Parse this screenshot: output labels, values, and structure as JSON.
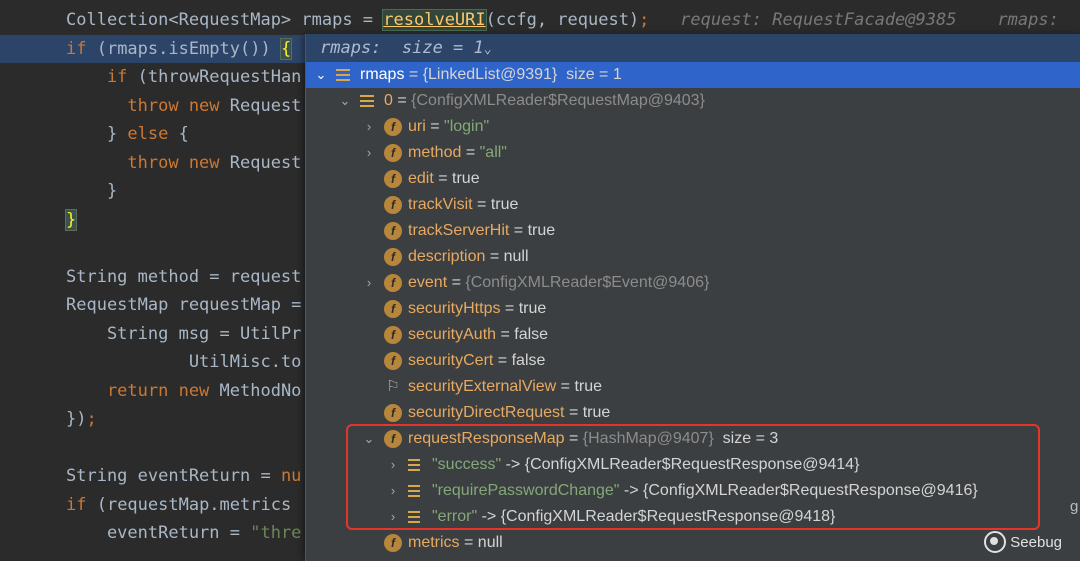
{
  "editor": {
    "lines": [
      {
        "id": "l1",
        "parts": [
          [
            "Collection<RequestMap> rmaps = ",
            ""
          ],
          [
            "resolveURI",
            "method-box"
          ],
          [
            "(ccfg, request)",
            ""
          ],
          [
            ";",
            "k"
          ],
          [
            "   request: RequestFacade@9385    rmaps:",
            "hint"
          ]
        ]
      },
      {
        "id": "l2",
        "parts": [
          [
            "if ",
            "k"
          ],
          [
            "(rmaps.isEmpty()) ",
            ""
          ],
          [
            "{",
            "brace-hl"
          ]
        ]
      },
      {
        "id": "l3",
        "parts": [
          [
            "    if ",
            "k"
          ],
          [
            "(throwRequestHan",
            ""
          ]
        ]
      },
      {
        "id": "l4",
        "parts": [
          [
            "      throw new ",
            "k"
          ],
          [
            "Request",
            ""
          ]
        ]
      },
      {
        "id": "l5",
        "parts": [
          [
            "    } ",
            ""
          ],
          [
            "else ",
            "k"
          ],
          [
            "{",
            ""
          ]
        ]
      },
      {
        "id": "l6",
        "parts": [
          [
            "      throw new ",
            "k"
          ],
          [
            "Request",
            ""
          ]
        ]
      },
      {
        "id": "l7",
        "parts": [
          [
            "    }",
            ""
          ]
        ]
      },
      {
        "id": "l8",
        "parts": [
          [
            "}",
            "brace-hl"
          ]
        ]
      },
      {
        "id": "l9",
        "parts": [
          [
            "",
            ""
          ]
        ]
      },
      {
        "id": "l10",
        "parts": [
          [
            "String method = request",
            ""
          ]
        ]
      },
      {
        "id": "l11",
        "parts": [
          [
            "RequestMap requestMap =",
            ""
          ]
        ]
      },
      {
        "id": "l12",
        "parts": [
          [
            "    String msg = UtilPr",
            ""
          ]
        ]
      },
      {
        "id": "l13",
        "parts": [
          [
            "            UtilMisc.to",
            ""
          ]
        ]
      },
      {
        "id": "l14",
        "parts": [
          [
            "    return new ",
            "k"
          ],
          [
            "MethodNo",
            ""
          ]
        ]
      },
      {
        "id": "l15",
        "parts": [
          [
            "})",
            ""
          ],
          [
            ";",
            "k"
          ]
        ]
      },
      {
        "id": "l16",
        "parts": [
          [
            "",
            ""
          ]
        ]
      },
      {
        "id": "l17",
        "parts": [
          [
            "String eventReturn = ",
            ""
          ],
          [
            "nu",
            "k"
          ]
        ]
      },
      {
        "id": "l18",
        "parts": [
          [
            "if ",
            "k"
          ],
          [
            "(requestMap.metrics",
            ""
          ]
        ]
      },
      {
        "id": "l19",
        "parts": [
          [
            "    eventReturn = ",
            ""
          ],
          [
            "\"thre",
            "s"
          ]
        ]
      }
    ]
  },
  "popup": {
    "header": "rmaps:  size = 1",
    "header_chevron": "⌄",
    "rows": [
      {
        "indent": 0,
        "arrow": "⌄",
        "icon": "list",
        "name": "rmaps",
        "eq": " = ",
        "value": "{LinkedList@9391}",
        "extra": "  size = 1",
        "selected": true
      },
      {
        "indent": 1,
        "arrow": "⌄",
        "icon": "list",
        "name": "0",
        "eq": " = ",
        "value": "{ConfigXMLReader$RequestMap@9403}",
        "vclass": "obj"
      },
      {
        "indent": 2,
        "arrow": "›",
        "icon": "f",
        "name": "uri",
        "eq": " = ",
        "value": "\"login\"",
        "vclass": "str"
      },
      {
        "indent": 2,
        "arrow": "›",
        "icon": "f",
        "name": "method",
        "eq": " = ",
        "value": "\"all\"",
        "vclass": "str"
      },
      {
        "indent": 2,
        "arrow": "",
        "icon": "f",
        "name": "edit",
        "eq": " = ",
        "value": "true"
      },
      {
        "indent": 2,
        "arrow": "",
        "icon": "f",
        "name": "trackVisit",
        "eq": " = ",
        "value": "true"
      },
      {
        "indent": 2,
        "arrow": "",
        "icon": "f",
        "name": "trackServerHit",
        "eq": " = ",
        "value": "true"
      },
      {
        "indent": 2,
        "arrow": "",
        "icon": "f",
        "name": "description",
        "eq": " = ",
        "value": "null"
      },
      {
        "indent": 2,
        "arrow": "›",
        "icon": "f",
        "name": "event",
        "eq": " = ",
        "value": "{ConfigXMLReader$Event@9406}",
        "vclass": "obj"
      },
      {
        "indent": 2,
        "arrow": "",
        "icon": "f",
        "name": "securityHttps",
        "eq": " = ",
        "value": "true"
      },
      {
        "indent": 2,
        "arrow": "",
        "icon": "f",
        "name": "securityAuth",
        "eq": " = ",
        "value": "false"
      },
      {
        "indent": 2,
        "arrow": "",
        "icon": "f",
        "name": "securityCert",
        "eq": " = ",
        "value": "false"
      },
      {
        "indent": 2,
        "arrow": "",
        "icon": "flag",
        "name": "securityExternalView",
        "eq": " = ",
        "value": "true"
      },
      {
        "indent": 2,
        "arrow": "",
        "icon": "f",
        "name": "securityDirectRequest",
        "eq": " = ",
        "value": "true"
      },
      {
        "indent": 2,
        "arrow": "⌄",
        "icon": "f",
        "name": "requestResponseMap",
        "eq": " = ",
        "value": "{HashMap@9407}",
        "vclass": "obj",
        "extra": "  size = 3"
      },
      {
        "indent": 3,
        "arrow": "›",
        "icon": "sq",
        "name": "\"success\"",
        "nclass": "str",
        "eq": " -> ",
        "value": "{ConfigXMLReader$RequestResponse@9414}"
      },
      {
        "indent": 3,
        "arrow": "›",
        "icon": "sq",
        "name": "\"requirePasswordChange\"",
        "nclass": "str",
        "eq": " -> ",
        "value": "{ConfigXMLReader$RequestResponse@9416}"
      },
      {
        "indent": 3,
        "arrow": "›",
        "icon": "sq",
        "name": "\"error\"",
        "nclass": "str",
        "eq": " -> ",
        "value": "{ConfigXMLReader$RequestResponse@9418}"
      },
      {
        "indent": 2,
        "arrow": "",
        "icon": "f",
        "name": "metrics",
        "eq": " = ",
        "value": "null"
      }
    ]
  },
  "watermark": {
    "text": "Seebug"
  },
  "edge_char": "g"
}
